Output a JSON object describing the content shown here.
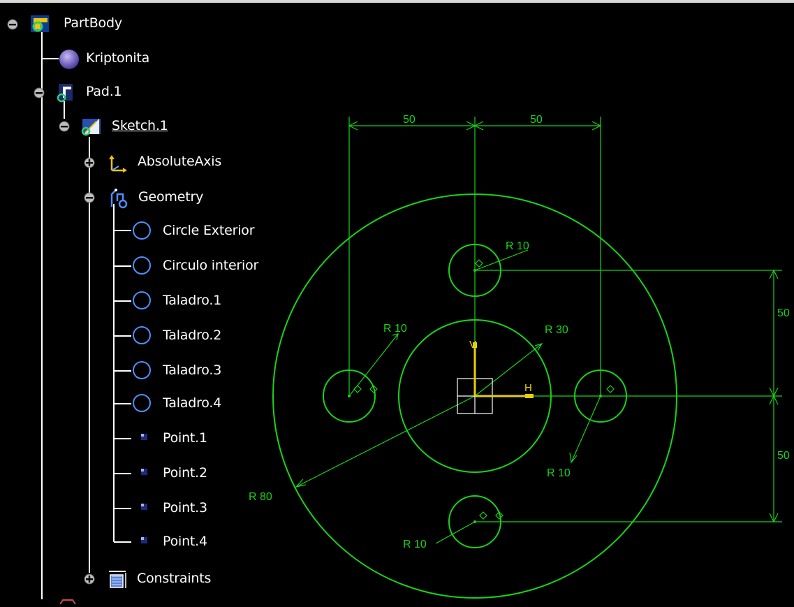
{
  "colors": {
    "background": "#000000",
    "tree_text": "#ffffff",
    "tree_lines": "#ffffff",
    "geometry": "#17d417",
    "axis": "#e6d000"
  },
  "tree": {
    "items": [
      {
        "label": "PartBody",
        "icon": "partbody-icon",
        "expander": "minus"
      },
      {
        "label": "Kriptonita",
        "icon": "material-sphere-icon",
        "expander": "none"
      },
      {
        "label": "Pad.1",
        "icon": "pad-icon",
        "expander": "minus"
      },
      {
        "label": "Sketch.1",
        "icon": "sketch-icon",
        "expander": "minus"
      },
      {
        "label": "AbsoluteAxis",
        "icon": "axis-icon",
        "expander": "plus"
      },
      {
        "label": "Geometry",
        "icon": "geometry-icon",
        "expander": "minus"
      },
      {
        "label": "Circle Exterior",
        "icon": "circle-icon",
        "expander": "none"
      },
      {
        "label": "Circulo interior",
        "icon": "circle-icon",
        "expander": "none"
      },
      {
        "label": "Taladro.1",
        "icon": "circle-icon",
        "expander": "none"
      },
      {
        "label": "Taladro.2",
        "icon": "circle-icon",
        "expander": "none"
      },
      {
        "label": "Taladro.3",
        "icon": "circle-icon",
        "expander": "none"
      },
      {
        "label": "Taladro.4",
        "icon": "circle-icon",
        "expander": "none"
      },
      {
        "label": "Point.1",
        "icon": "point-icon",
        "expander": "none"
      },
      {
        "label": "Point.2",
        "icon": "point-icon",
        "expander": "none"
      },
      {
        "label": "Point.3",
        "icon": "point-icon",
        "expander": "none"
      },
      {
        "label": "Point.4",
        "icon": "point-icon",
        "expander": "none"
      },
      {
        "label": "Constraints",
        "icon": "constraints-icon",
        "expander": "plus"
      }
    ]
  },
  "sketch": {
    "dim_top_left": "50",
    "dim_top_right": "50",
    "dim_right_upper": "50",
    "dim_right_lower": "50",
    "radius_outer": "R 80",
    "radius_inner": "R 30",
    "radius_hole_top": "R 10",
    "radius_hole_left": "R 10",
    "radius_hole_right": "R 10",
    "radius_hole_bottom": "R 10",
    "axis_h": "H",
    "axis_v": "V"
  }
}
